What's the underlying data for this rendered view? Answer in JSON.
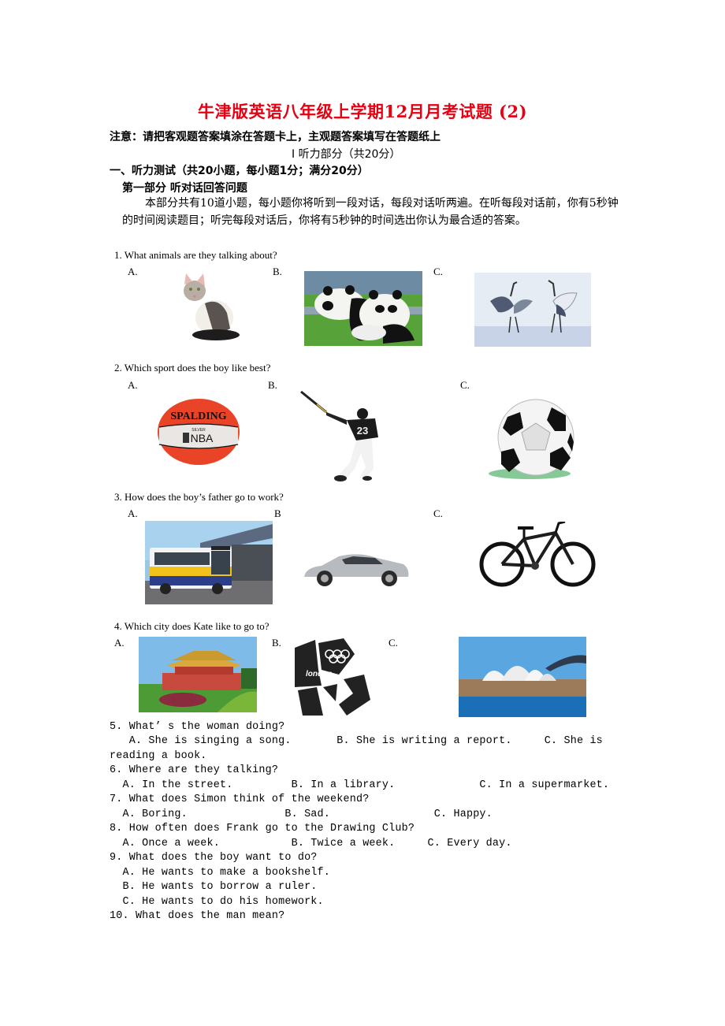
{
  "document": {
    "title": "牛津版英语八年级上学期12月月考试题 (2)",
    "notice": "注意：请把客观题答案填涂在答题卡上，主观题答案填写在答题纸上",
    "section_heading": "I  听力部分（共20分）",
    "part_heading": "一、听力测试（共20小题，每小题1分；满分20分）",
    "subpart_heading": "第一部分   听对话回答问题",
    "instructions": "本部分共有10道小题，每小题你将听到一段对话，每段对话听两遍。在听每段对话前，你有5秒钟的时间阅读题目；听完每段对话后，你将有5秒钟的时间选出你认为最合适的答案。"
  },
  "picture_questions": [
    {
      "question": "1. What animals are they talking about?",
      "options": [
        {
          "label": "A.",
          "image": "cat"
        },
        {
          "label": "B.",
          "image": "pandas"
        },
        {
          "label": "C.",
          "image": "cranes"
        }
      ]
    },
    {
      "question": "2. Which sport does the boy like best?",
      "options": [
        {
          "label": "A.",
          "image": "basketball",
          "ball_text": [
            "SPALDING",
            "SILVER",
            "NBA"
          ]
        },
        {
          "label": "B.",
          "image": "baseball-batter",
          "jersey_number": "23"
        },
        {
          "label": "C.",
          "image": "soccer-ball"
        }
      ]
    },
    {
      "question": "3. How does the boy’s father go to work?",
      "options": [
        {
          "label": "A.",
          "image": "bus"
        },
        {
          "label": "B",
          "image": "car"
        },
        {
          "label": "C.",
          "image": "bicycle"
        }
      ]
    },
    {
      "question": "4. Which city does Kate like to go to?",
      "options": [
        {
          "label": "A.",
          "image": "tiananmen-beijing"
        },
        {
          "label": "B.",
          "image": "london-2012-logo",
          "logo_text": "london"
        },
        {
          "label": "C.",
          "image": "sydney-opera-house"
        }
      ]
    }
  ],
  "text_questions": [
    {
      "question": "5. What’ s the woman doing?",
      "line1": "   A. She is singing a song.       B. She is writing a report.     C. She is",
      "line2": "reading a book."
    },
    {
      "question": "6. Where are they talking?",
      "line1": "  A. In the street.         B. In a library.             C. In a supermarket."
    },
    {
      "question": "7. What does Simon think of the weekend?",
      "line1": "  A. Boring.               B. Sad.                C. Happy."
    },
    {
      "question": "8. How often does Frank go to the Drawing Club?",
      "line1": "  A. Once a week.           B. Twice a week.     C. Every day."
    },
    {
      "question": "9. What does the boy want to do?",
      "options": [
        "  A. He wants to make a bookshelf.",
        "  B. He wants to borrow a ruler.",
        "  C. He wants to do his homework."
      ]
    },
    {
      "question": "10. What does the man mean?"
    }
  ]
}
